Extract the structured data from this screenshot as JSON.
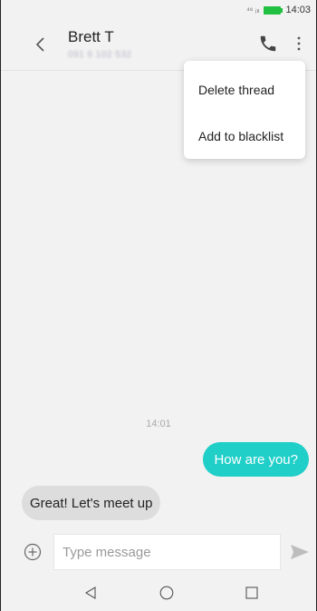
{
  "status_bar": {
    "network_label": "⁴⁶ ᵢₗₗ",
    "time": "14:03",
    "battery_color": "#21c040"
  },
  "header": {
    "contact_name": "Brett T",
    "contact_number": "091 6 102 532",
    "icons": [
      "back-icon",
      "call-icon",
      "more-icon"
    ]
  },
  "menu": {
    "items": [
      {
        "label": "Delete thread"
      },
      {
        "label": "Add to blacklist"
      }
    ]
  },
  "conversation": {
    "timestamp": "14:01",
    "messages": [
      {
        "direction": "outgoing",
        "text": "How are you?",
        "color": "#1fcfc8"
      },
      {
        "direction": "incoming",
        "text": "Great! Let's meet up",
        "color": "#dddddd"
      }
    ]
  },
  "composer": {
    "placeholder": "Type message",
    "value": "",
    "icons": [
      "add-icon",
      "send-icon"
    ]
  },
  "navigation": {
    "icons": [
      "nav-back-icon",
      "nav-home-icon",
      "nav-recents-icon"
    ]
  }
}
